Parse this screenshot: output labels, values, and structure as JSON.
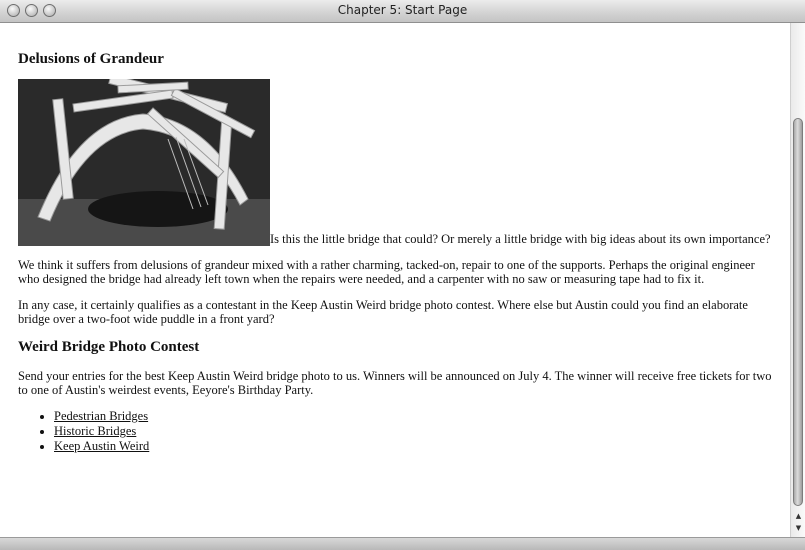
{
  "window": {
    "title": "Chapter 5: Start Page"
  },
  "page": {
    "heading1": "Delusions of Grandeur",
    "intro_text": "Is this the little bridge that could? Or merely a little bridge with big ideas about its own importance?",
    "paragraph2": "We think it suffers from delusions of grandeur mixed with a rather charming, tacked-on, repair to one of the supports. Perhaps the original engineer who designed the bridge had already left town when the repairs were needed, and a carpenter with no saw or measuring tape had to fix it.",
    "paragraph3": "In any case, it certainly qualifies as a contestant in the Keep Austin Weird bridge photo contest. Where else but Austin could you find an elaborate bridge over a two-foot wide puddle in a front yard?",
    "heading2": "Weird Bridge Photo Contest",
    "paragraph4": "Send your entries for the best Keep Austin Weird bridge photo to us. Winners will be announced on July 4. The winner will receive free tickets for two to one of Austin's weirdest events, Eeyore's Birthday Party.",
    "links": [
      {
        "label": "Pedestrian Bridges"
      },
      {
        "label": "Historic Bridges"
      },
      {
        "label": "Keep Austin Weird"
      }
    ]
  },
  "icons": {
    "close": "close-button-circle",
    "minimize": "minimize-button-circle",
    "zoom": "zoom-button-circle",
    "scroll_up": "arrow-up-icon",
    "scroll_down": "arrow-down-icon"
  }
}
